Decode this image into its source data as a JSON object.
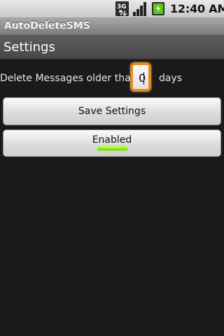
{
  "status_bar": {
    "network_icon": "3g-icon",
    "signal_icon": "signal-bars-icon",
    "battery_icon": "battery-charging-icon",
    "time": "12:40 AM"
  },
  "app": {
    "title": "AutoDeleteSMS"
  },
  "section": {
    "title": "Settings"
  },
  "settings": {
    "delete_label": "Delete Messages older than",
    "days_value": "0",
    "days_label": "days"
  },
  "buttons": {
    "save_label": "Save Settings",
    "toggle_label": "Enabled",
    "toggle_on": true
  },
  "colors": {
    "input_focus": "#f08a1c",
    "toggle_indicator": "#7bdc00",
    "background": "#1a1a1a"
  }
}
